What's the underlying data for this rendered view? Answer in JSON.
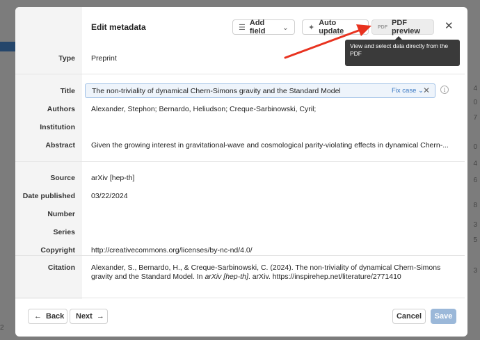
{
  "background": {
    "side_numbers": [
      "4",
      "0",
      "7",
      "0",
      "4",
      "6",
      "8",
      "3",
      "5",
      "3"
    ],
    "left_number": "2"
  },
  "modal": {
    "title": "Edit metadata",
    "add_field_label": "Add field",
    "auto_update_label": "Auto update",
    "pdf_tag": "PDF",
    "pdf_preview_label": "PDF preview",
    "tooltip": "View and select data directly from the PDF"
  },
  "fields": {
    "type_label": "Type",
    "type_value": "Preprint",
    "title_label": "Title",
    "title_value": "The non-triviality of dynamical Chern-Simons gravity and the Standard Model",
    "fix_case": "Fix case",
    "authors_label": "Authors",
    "authors_value": "Alexander, Stephon; Bernardo, Heliudson; Creque-Sarbinowski, Cyril;",
    "institution_label": "Institution",
    "abstract_label": "Abstract",
    "abstract_value": "Given the growing interest in gravitational-wave and cosmological parity-violating effects in dynamical Chern-...",
    "source_label": "Source",
    "source_value": "arXiv [hep-th]",
    "date_label": "Date published",
    "date_value": "03/22/2024",
    "number_label": "Number",
    "series_label": "Series",
    "copyright_label": "Copyright",
    "copyright_value": "http://creativecommons.org/licenses/by-nc-nd/4.0/",
    "citation_label": "Citation",
    "citation_part1": "Alexander, S., Bernardo, H., & Creque-Sarbinowski, C. (2024). The non-triviality of dynamical Chern-Simons gravity and the Standard Model. In ",
    "citation_italic": "arXiv [hep-th]",
    "citation_part2": ". arXiv. https://inspirehep.net/literature/2771410"
  },
  "footer": {
    "back_label": "Back",
    "next_label": "Next",
    "cancel_label": "Cancel",
    "save_label": "Save"
  },
  "colors": {
    "accent_arrow": "#e8321f",
    "save_disabled": "#9bb8d9",
    "link": "#3a78c2"
  }
}
